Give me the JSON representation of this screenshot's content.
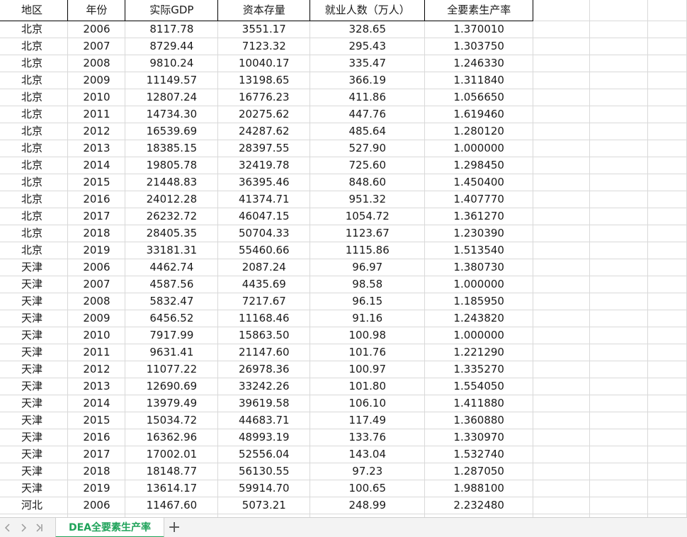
{
  "headers": [
    "地区",
    "年份",
    "实际GDP",
    "资本存量",
    "就业人数（万人）",
    "全要素生产率"
  ],
  "rows": [
    [
      "北京",
      "2006",
      "8117.78",
      "3551.17",
      "328.65",
      "1.370010"
    ],
    [
      "北京",
      "2007",
      "8729.44",
      "7123.32",
      "295.43",
      "1.303750"
    ],
    [
      "北京",
      "2008",
      "9810.24",
      "10040.17",
      "335.47",
      "1.246330"
    ],
    [
      "北京",
      "2009",
      "11149.57",
      "13198.65",
      "366.19",
      "1.311840"
    ],
    [
      "北京",
      "2010",
      "12807.24",
      "16776.23",
      "411.86",
      "1.056650"
    ],
    [
      "北京",
      "2011",
      "14734.30",
      "20275.62",
      "447.76",
      "1.619460"
    ],
    [
      "北京",
      "2012",
      "16539.69",
      "24287.62",
      "485.64",
      "1.280120"
    ],
    [
      "北京",
      "2013",
      "18385.15",
      "28397.55",
      "527.90",
      "1.000000"
    ],
    [
      "北京",
      "2014",
      "19805.78",
      "32419.78",
      "725.60",
      "1.298450"
    ],
    [
      "北京",
      "2015",
      "21448.83",
      "36395.46",
      "848.60",
      "1.450400"
    ],
    [
      "北京",
      "2016",
      "24012.28",
      "41374.71",
      "951.32",
      "1.407770"
    ],
    [
      "北京",
      "2017",
      "26232.72",
      "46047.15",
      "1054.72",
      "1.361270"
    ],
    [
      "北京",
      "2018",
      "28405.35",
      "50704.33",
      "1123.67",
      "1.230390"
    ],
    [
      "北京",
      "2019",
      "33181.31",
      "55460.66",
      "1115.86",
      "1.513540"
    ],
    [
      "天津",
      "2006",
      "4462.74",
      "2087.24",
      "96.97",
      "1.380730"
    ],
    [
      "天津",
      "2007",
      "4587.56",
      "4435.69",
      "98.58",
      "1.000000"
    ],
    [
      "天津",
      "2008",
      "5832.47",
      "7217.67",
      "96.15",
      "1.185950"
    ],
    [
      "天津",
      "2009",
      "6456.52",
      "11168.46",
      "91.16",
      "1.243820"
    ],
    [
      "天津",
      "2010",
      "7917.99",
      "15863.50",
      "100.98",
      "1.000000"
    ],
    [
      "天津",
      "2011",
      "9631.41",
      "21147.60",
      "101.76",
      "1.221290"
    ],
    [
      "天津",
      "2012",
      "11077.22",
      "26978.36",
      "100.97",
      "1.335270"
    ],
    [
      "天津",
      "2013",
      "12690.69",
      "33242.26",
      "101.80",
      "1.554050"
    ],
    [
      "天津",
      "2014",
      "13979.49",
      "39619.58",
      "106.10",
      "1.411880"
    ],
    [
      "天津",
      "2015",
      "15034.72",
      "44683.71",
      "117.49",
      "1.360880"
    ],
    [
      "天津",
      "2016",
      "16362.96",
      "48993.19",
      "133.76",
      "1.330970"
    ],
    [
      "天津",
      "2017",
      "17002.01",
      "52556.04",
      "143.04",
      "1.532740"
    ],
    [
      "天津",
      "2018",
      "18148.77",
      "56130.55",
      "97.23",
      "1.287050"
    ],
    [
      "天津",
      "2019",
      "13614.17",
      "59914.70",
      "100.65",
      "1.988100"
    ],
    [
      "河北",
      "2006",
      "11467.60",
      "5073.21",
      "248.99",
      "2.232480"
    ]
  ],
  "sheet_tab": "DEA全要素生产率",
  "icons": {
    "prev": "chevron-left-icon",
    "next": "chevron-right-icon",
    "last": "chevron-last-icon",
    "add": "plus-icon"
  },
  "accent_color": "#1fa35a"
}
